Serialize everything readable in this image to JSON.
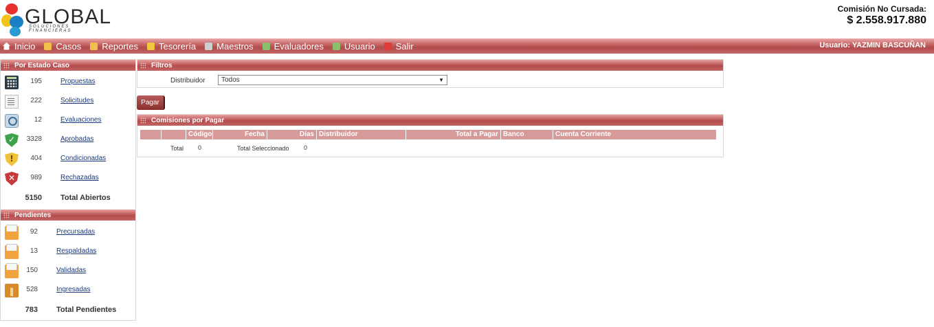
{
  "header": {
    "logo_text": "GLOBAL",
    "logo_subtitle": "SOLUCIONES FINANCIERAS",
    "commission_label": "Comisión No Cursada:",
    "commission_value": "$ 2.558.917.880"
  },
  "menu": {
    "items": [
      {
        "label": "Inicio",
        "icon": "home-icon"
      },
      {
        "label": "Casos",
        "icon": "folder-icon"
      },
      {
        "label": "Reportes",
        "icon": "folder-icon"
      },
      {
        "label": "Tesorería",
        "icon": "coin-icon"
      },
      {
        "label": "Maestros",
        "icon": "database-icon"
      },
      {
        "label": "Evaluadores",
        "icon": "checklist-icon"
      },
      {
        "label": "Usuario",
        "icon": "checklist-icon"
      },
      {
        "label": "Salir",
        "icon": "exit-icon"
      }
    ],
    "user_label": "Usuario:",
    "user_name": "YAZMIN BASCUÑAN"
  },
  "sidebar": {
    "estado": {
      "title": "Por Estado Caso",
      "items": [
        {
          "count": "195",
          "label": "Propuestas",
          "icon": "calculator-icon"
        },
        {
          "count": "222",
          "label": "Solicitudes",
          "icon": "notepad-icon"
        },
        {
          "count": "12",
          "label": "Evaluaciones",
          "icon": "magnifier-icon"
        },
        {
          "count": "3328",
          "label": "Aprobadas",
          "icon": "shield-check-icon"
        },
        {
          "count": "404",
          "label": "Condicionadas",
          "icon": "shield-warning-icon"
        },
        {
          "count": "989",
          "label": "Rechazadas",
          "icon": "shield-x-icon"
        }
      ],
      "total_count": "5150",
      "total_label": "Total Abiertos"
    },
    "pendientes": {
      "title": "Pendientes",
      "items": [
        {
          "count": "92",
          "label": "Precursadas",
          "icon": "folder-docs-icon"
        },
        {
          "count": "13",
          "label": "Respaldadas",
          "icon": "folder-docs-icon"
        },
        {
          "count": "150",
          "label": "Validadas",
          "icon": "folder-docs-icon"
        },
        {
          "count": "528",
          "label": "Ingresadas",
          "icon": "box-icon"
        }
      ],
      "total_count": "783",
      "total_label": "Total Pendientes"
    }
  },
  "filtros": {
    "title": "Filtros",
    "distribuidor_label": "Distribuidor",
    "distribuidor_value": "Todos"
  },
  "actions": {
    "pagar_label": "Pagar"
  },
  "comisiones": {
    "title": "Comisiones por Pagar",
    "columns": [
      "",
      "",
      "Código",
      "Fecha",
      "Días",
      "Distribuidor",
      "Total a Pagar",
      "Banco",
      "Cuenta Corriente"
    ],
    "total_label": "Total",
    "total_value": "0",
    "selected_label": "Total Seleccionado",
    "selected_value": "0"
  },
  "colors": {
    "accent": "#b24c4c",
    "table_header": "#d69a9a",
    "link": "#1a3a7a"
  }
}
